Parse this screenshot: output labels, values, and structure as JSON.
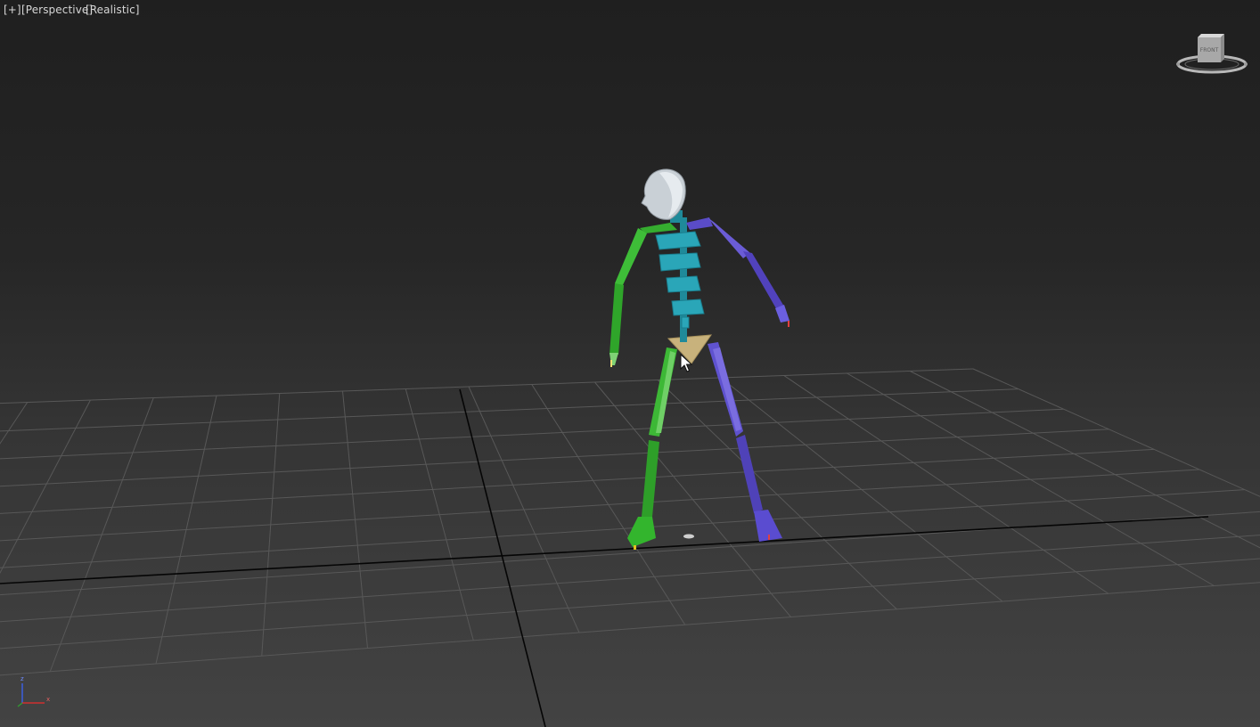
{
  "viewport": {
    "labels": {
      "plus": "[+]",
      "view": "[Perspective]",
      "shading": "[Realistic]"
    },
    "viewcube": {
      "face_label": "FRONT"
    },
    "axis_tripod": {
      "labels": [
        "z",
        "x"
      ]
    }
  },
  "scene": {
    "object": "biped-skeleton",
    "colors": {
      "left_side": "#2fa52a",
      "right_side": "#5a4cc8",
      "spine": "#2aa6b8",
      "pelvis": "#c8b27c",
      "head": "#c9d0d6",
      "grid": "#555555"
    }
  }
}
